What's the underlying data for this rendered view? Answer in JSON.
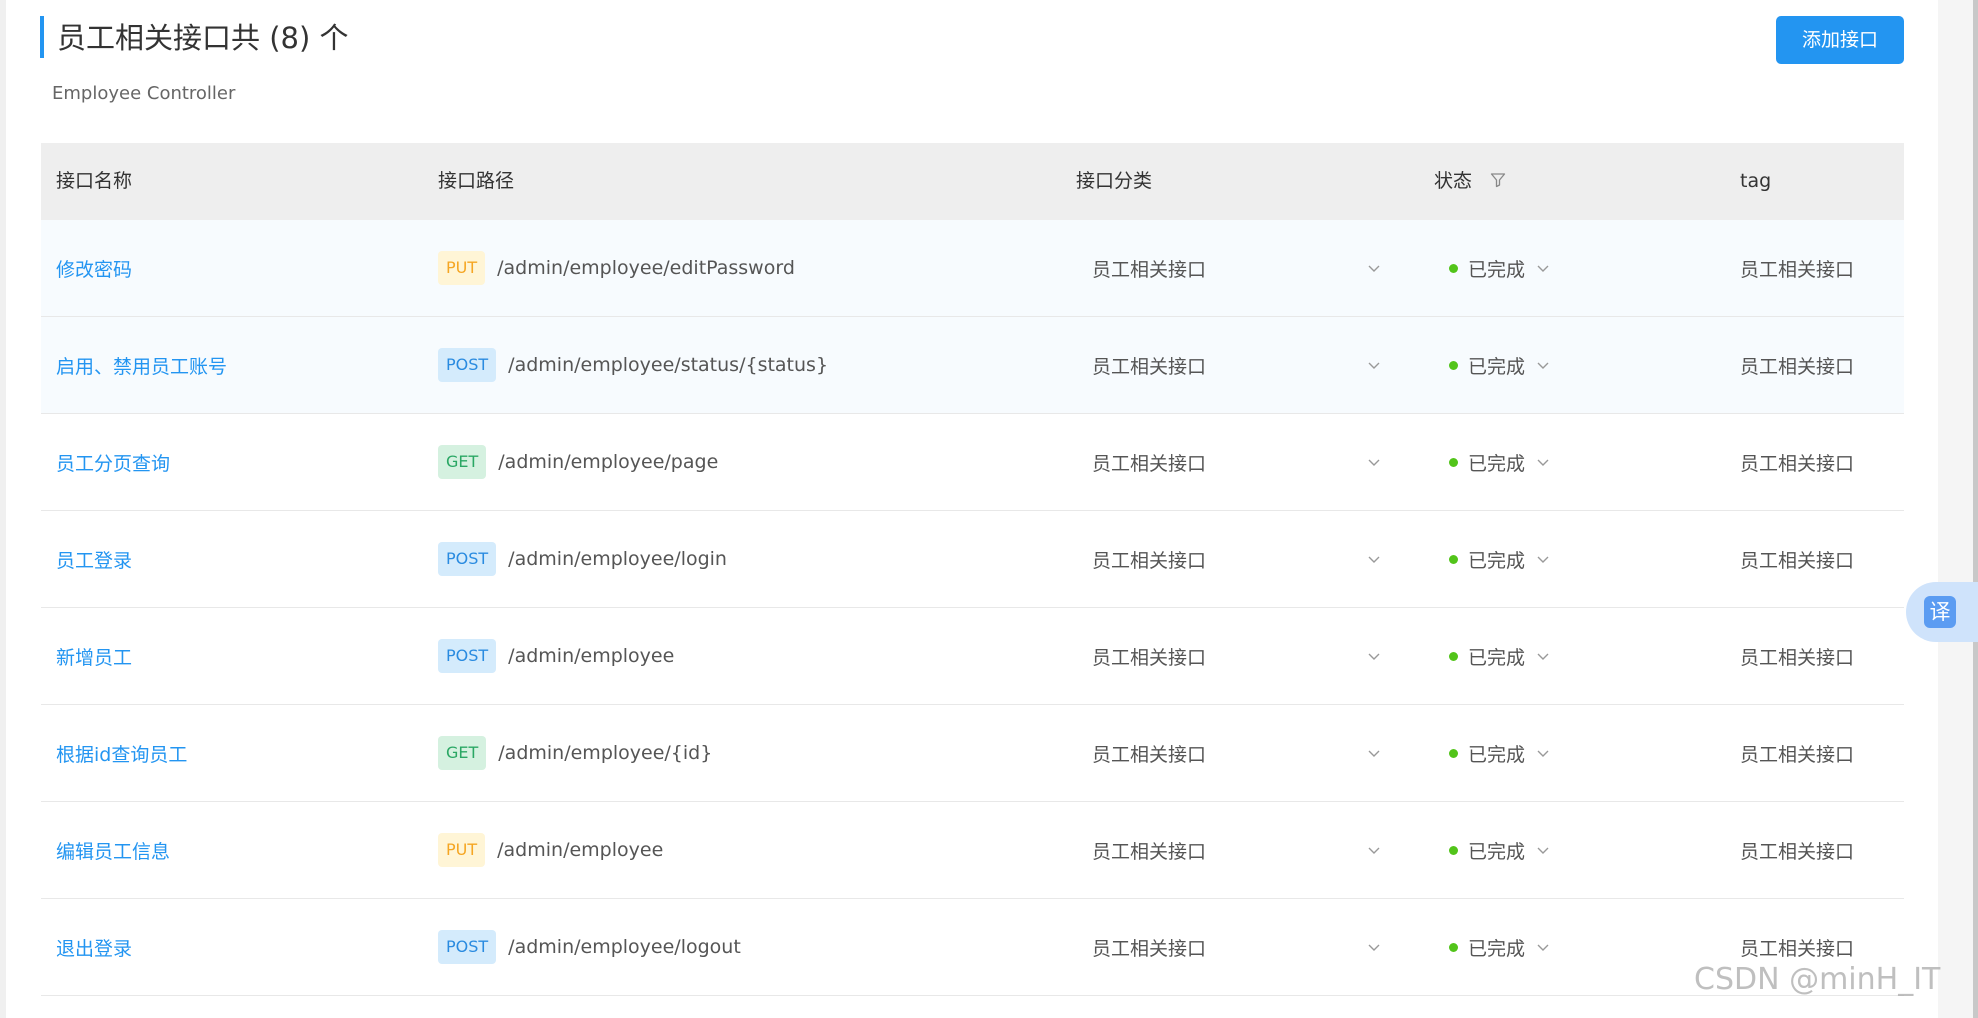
{
  "header": {
    "title": "员工相关接口共 (8) 个",
    "subtitle": "Employee Controller",
    "add_button": "添加接口"
  },
  "table": {
    "columns": [
      "接口名称",
      "接口路径",
      "接口分类",
      "状态",
      "tag"
    ],
    "rows": [
      {
        "name": "修改密码",
        "method": "PUT",
        "path": "/admin/employee/editPassword",
        "category": "员工相关接口",
        "status": "已完成",
        "tag": "员工相关接口"
      },
      {
        "name": "启用、禁用员工账号",
        "method": "POST",
        "path": "/admin/employee/status/{status}",
        "category": "员工相关接口",
        "status": "已完成",
        "tag": "员工相关接口"
      },
      {
        "name": "员工分页查询",
        "method": "GET",
        "path": "/admin/employee/page",
        "category": "员工相关接口",
        "status": "已完成",
        "tag": "员工相关接口"
      },
      {
        "name": "员工登录",
        "method": "POST",
        "path": "/admin/employee/login",
        "category": "员工相关接口",
        "status": "已完成",
        "tag": "员工相关接口"
      },
      {
        "name": "新增员工",
        "method": "POST",
        "path": "/admin/employee",
        "category": "员工相关接口",
        "status": "已完成",
        "tag": "员工相关接口"
      },
      {
        "name": "根据id查询员工",
        "method": "GET",
        "path": "/admin/employee/{id}",
        "category": "员工相关接口",
        "status": "已完成",
        "tag": "员工相关接口"
      },
      {
        "name": "编辑员工信息",
        "method": "PUT",
        "path": "/admin/employee",
        "category": "员工相关接口",
        "status": "已完成",
        "tag": "员工相关接口"
      },
      {
        "name": "退出登录",
        "method": "POST",
        "path": "/admin/employee/logout",
        "category": "员工相关接口",
        "status": "已完成",
        "tag": "员工相关接口"
      }
    ]
  },
  "translate_button": "译",
  "watermark": "CSDN @minH_IT",
  "colors": {
    "accent": "#2395f1",
    "status_done": "#52c41a",
    "put": "#f5a623",
    "post": "#2a8be0",
    "get": "#2aa764"
  },
  "icons": {
    "status_filter": "filter-icon",
    "category_dropdown": "chevron-down-icon",
    "status_dropdown": "chevron-down-icon",
    "translate": "translate-icon"
  }
}
